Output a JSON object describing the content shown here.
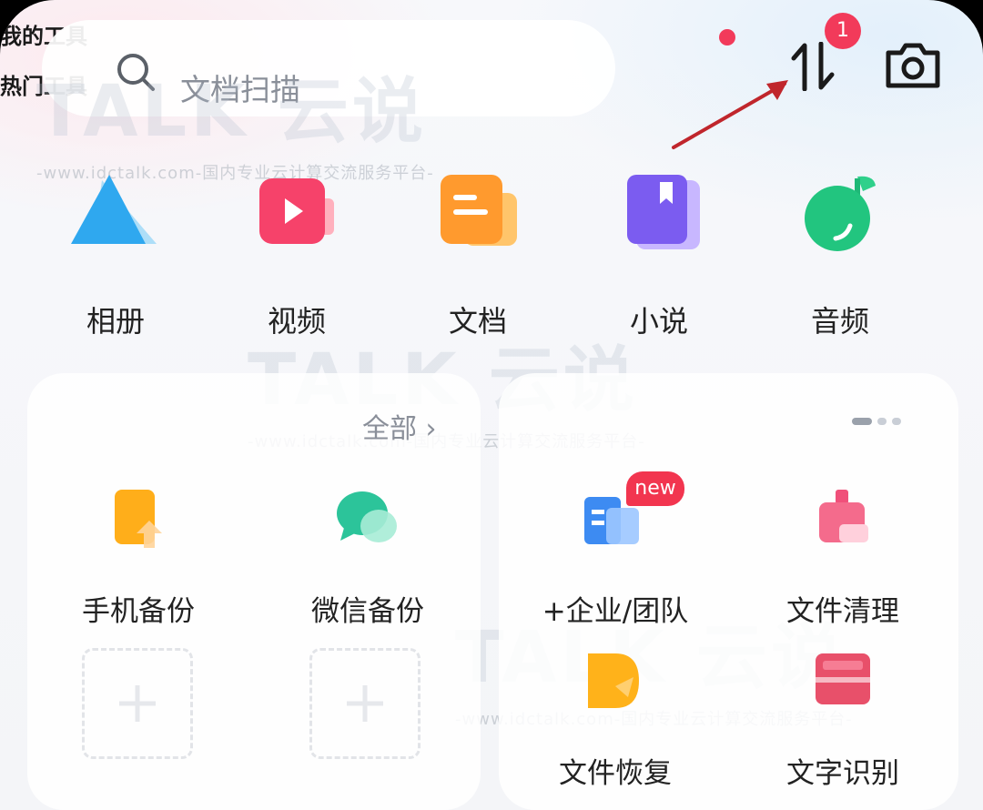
{
  "search": {
    "placeholder": "文档扫描"
  },
  "top": {
    "badge_count": "1"
  },
  "categories": [
    {
      "label": "相册",
      "icon": "photo-album-icon"
    },
    {
      "label": "视频",
      "icon": "video-icon"
    },
    {
      "label": "文档",
      "icon": "document-icon"
    },
    {
      "label": "小说",
      "icon": "novel-book-icon"
    },
    {
      "label": "音频",
      "icon": "audio-icon"
    }
  ],
  "my_tools": {
    "title": "我的工具",
    "all_label": "全部",
    "items": [
      {
        "label": "手机备份",
        "icon": "phone-backup-icon"
      },
      {
        "label": "微信备份",
        "icon": "wechat-backup-icon"
      }
    ]
  },
  "hot_tools": {
    "title": "热门工具",
    "new_tag": "new",
    "items": [
      {
        "label": "+企业/团队",
        "icon": "enterprise-team-icon"
      },
      {
        "label": "文件清理",
        "icon": "file-cleanup-icon"
      },
      {
        "label": "文件恢复",
        "icon": "file-recovery-icon"
      },
      {
        "label": "文字识别",
        "icon": "ocr-icon"
      }
    ]
  },
  "watermark": {
    "brand": "TALK 云说",
    "url": "-www.idctalk.com-国内专业云计算交流服务平台-"
  },
  "colors": {
    "badge": "#f23a5a",
    "annotation_arrow": "#c0262c"
  }
}
